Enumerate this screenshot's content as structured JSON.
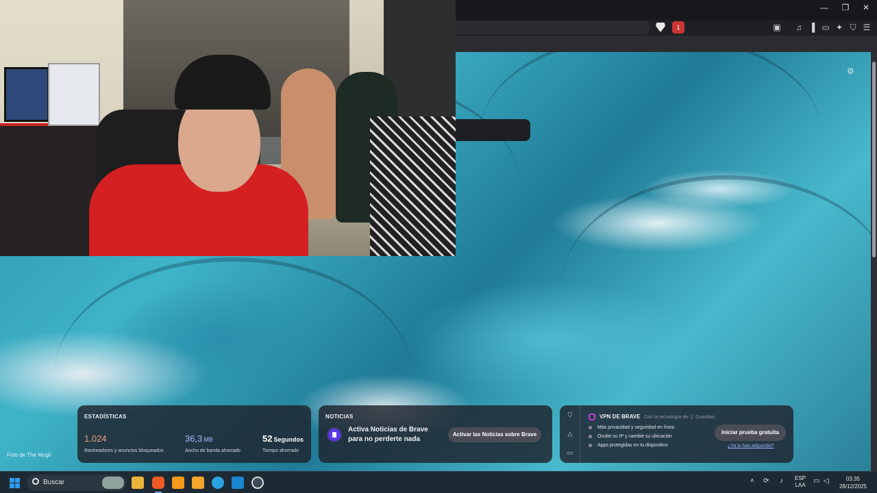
{
  "browser": {
    "window_controls": {
      "minimize": "—",
      "restore": "❐",
      "close": "✕"
    },
    "rewards_badge_count": "1"
  },
  "wallpaper": {
    "photo_credit": "Foto de The Mogli"
  },
  "stats_card": {
    "title": "ESTADÍSTICAS",
    "items": [
      {
        "value": "1.024",
        "unit": "",
        "label": "Rastreadores y anuncios bloqueados",
        "color": "#f39b7f"
      },
      {
        "value": "36,3",
        "unit": "MB",
        "label": "Ancho de banda ahorrado",
        "color": "#a9b8ff"
      },
      {
        "value": "52",
        "unit": "Segundos",
        "label": "Tiempo ahorrado",
        "color": "#ffffff"
      }
    ]
  },
  "news_card": {
    "title": "NOTICIAS",
    "message": "Activa Noticias de Brave para no perderte nada",
    "button_label": "Activar las Noticias sobre Brave"
  },
  "vpn_card": {
    "title": "VPN DE BRAVE",
    "powered_by": "Con la tecnología de ⓖ Guardian",
    "features": [
      "Más privacidad y seguridad en línea",
      "Oculte su IP y cambie su ubicación",
      "Apps protegidas en tu dispositivo"
    ],
    "button_label": "Iniciar prueba gratuita",
    "link_label": "¿Ya lo has adquirido?"
  },
  "taskbar": {
    "search_placeholder": "Buscar",
    "language": "ESP",
    "layout": "LAA",
    "time": "03:35",
    "date": "28/12/2025"
  }
}
